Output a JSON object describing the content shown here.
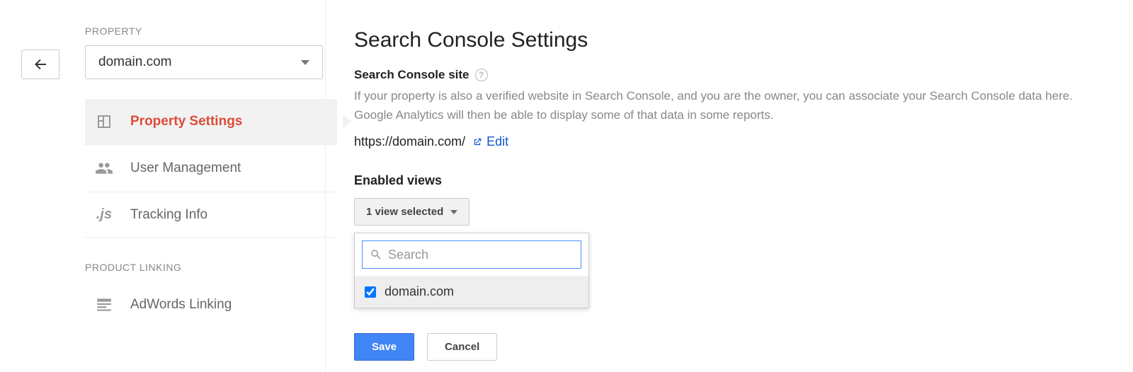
{
  "sidebar": {
    "section_property": "PROPERTY",
    "property_select_value": "domain.com",
    "items": [
      {
        "label": "Property Settings"
      },
      {
        "label": "User Management"
      },
      {
        "label": "Tracking Info"
      }
    ],
    "section_product_linking": "PRODUCT LINKING",
    "adwords_linking": "AdWords Linking"
  },
  "main": {
    "title": "Search Console Settings",
    "site_heading": "Search Console site",
    "description": "If your property is also a verified website in Search Console, and you are the owner, you can associate your Search Console data here. Google Analytics will then be able to display some of that data in some reports.",
    "site_url": "https://domain.com/",
    "edit_label": "Edit",
    "enabled_views_label": "Enabled views",
    "dropdown_toggle": "1 view selected",
    "search_placeholder": "Search",
    "options": [
      {
        "label": "domain.com",
        "checked": true
      }
    ],
    "save_label": "Save",
    "cancel_label": "Cancel"
  }
}
